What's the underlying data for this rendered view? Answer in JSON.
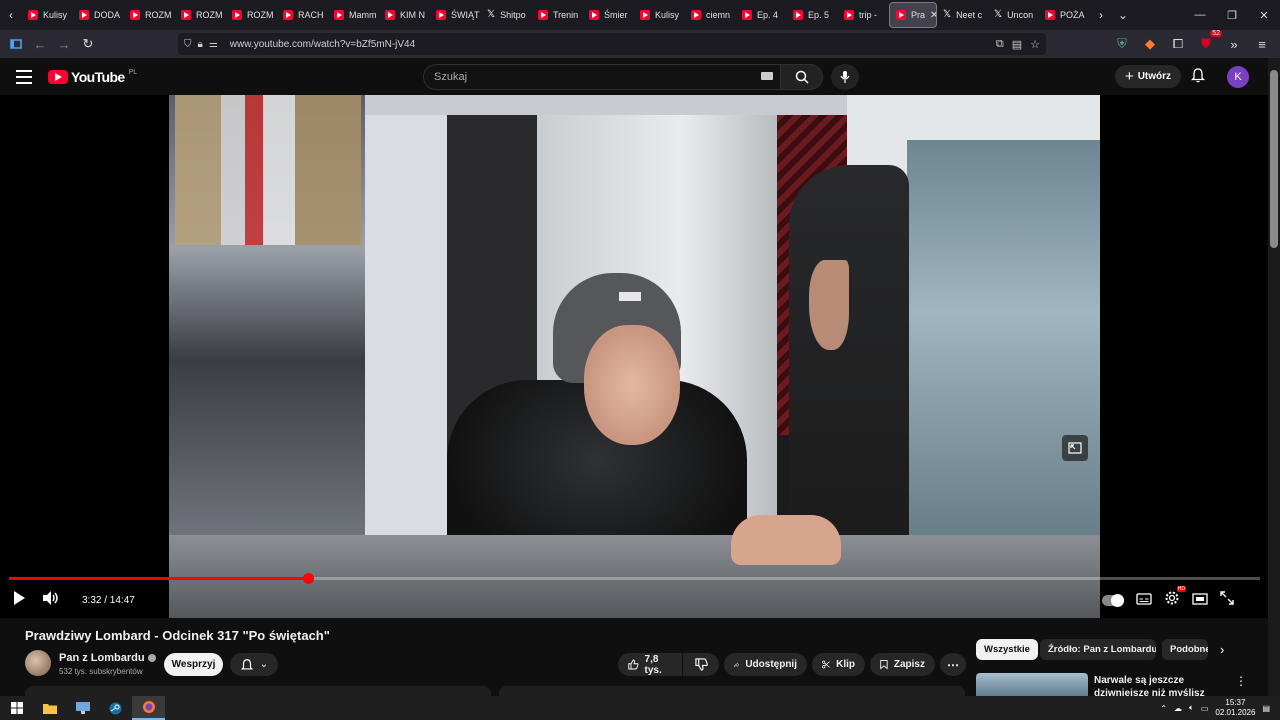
{
  "browser": {
    "tabs": [
      {
        "label": "Kulisy",
        "kind": "yt"
      },
      {
        "label": "DODA",
        "kind": "yt"
      },
      {
        "label": "ROZM",
        "kind": "yt"
      },
      {
        "label": "ROZM",
        "kind": "yt"
      },
      {
        "label": "ROZM",
        "kind": "yt"
      },
      {
        "label": "RACH",
        "kind": "yt"
      },
      {
        "label": "Mamm",
        "kind": "yt"
      },
      {
        "label": "KIM N",
        "kind": "yt"
      },
      {
        "label": "ŚWIĄT",
        "kind": "yt"
      },
      {
        "label": "Shitpo",
        "kind": "x"
      },
      {
        "label": "Trenin",
        "kind": "yt"
      },
      {
        "label": "Śmier",
        "kind": "yt"
      },
      {
        "label": "Kulisy",
        "kind": "yt"
      },
      {
        "label": "ciemn",
        "kind": "yt"
      },
      {
        "label": "Ep. 4",
        "kind": "yt"
      },
      {
        "label": "Ep. 5",
        "kind": "yt"
      },
      {
        "label": "trip -",
        "kind": "yt"
      },
      {
        "label": "Pra",
        "kind": "yt",
        "active": true
      },
      {
        "label": "Neet c",
        "kind": "x"
      },
      {
        "label": "Uncon",
        "kind": "x"
      },
      {
        "label": "POŻA",
        "kind": "yt"
      }
    ],
    "url": "www.youtube.com/watch?v=bZf5mN-jV44",
    "extensions_badge": "52"
  },
  "youtube": {
    "logo_text": "YouTube",
    "region": "PL",
    "search_placeholder": "Szukaj",
    "create_label": "Utwórz",
    "avatar_letter": "K"
  },
  "player": {
    "current_time": "3:32",
    "duration": "14:47",
    "time_display": "3:32 / 14:47",
    "progress_fraction": 0.239,
    "hd_badge": "HD"
  },
  "video": {
    "title": "Prawdziwy Lombard - Odcinek 317 \"Po świętach\"",
    "channel": "Pan z Lombardu",
    "subscribers": "532 tys. subskrybentów",
    "support_label": "Wesprzyj",
    "likes": "7,8 tys.",
    "share_label": "Udostępnij",
    "clip_label": "Klip",
    "save_label": "Zapisz"
  },
  "sidebar": {
    "chips": [
      "Wszystkie",
      "Źródło: Pan z Lombardu",
      "Podobne"
    ],
    "rec_title": "Narwale są jeszcze dziwniejsze niż myślisz"
  },
  "taskbar": {
    "time": "15:37",
    "date": "02.01.2026"
  },
  "colors": {
    "accent_red": "#ff0000",
    "background": "#0f0f0f"
  }
}
